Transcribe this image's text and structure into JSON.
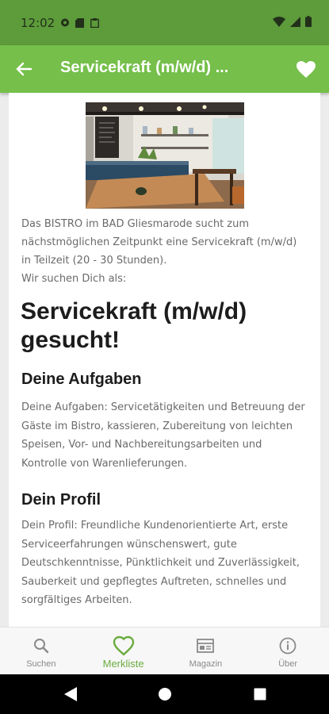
{
  "status_bar": {
    "time": "12:02"
  },
  "app_bar": {
    "title": "Servicekraft (m/w/d) ..."
  },
  "content": {
    "intro": "Das BISTRO im BAD Gliesmarode sucht zum nächstmöglichen Zeitpunkt eine Servicekraft (m/w/d) in Teilzeit (20 - 30 Stunden).\nWir suchen Dich als:",
    "headline": "Servicekraft (m/w/d) gesucht!",
    "tasks_title": "Deine Aufgaben",
    "tasks_text": "Deine Aufgaben: Servicetätigkeiten und Betreuung der Gäste im Bistro, kassieren, Zubereitung von leichten Speisen, Vor- und Nachbereitungsarbeiten und Kontrolle von Warenlieferungen.",
    "profile_title": "Dein Profil",
    "profile_text": "Dein Profil: Freundliche Kundenorientierte Art, erste Serviceerfahrungen wünschenswert, gute Deutschkenntnisse, Pünktlichkeit und Zuverlässigkeit, Sauberkeit und gepflegtes Auftreten, schnelles und sorgfältiges Arbeiten."
  },
  "bottom_nav": {
    "items": [
      {
        "label": "Suchen",
        "icon": "search-icon"
      },
      {
        "label": "Merkliste",
        "icon": "heart-outline-icon",
        "active": true
      },
      {
        "label": "Magazin",
        "icon": "newspaper-icon"
      },
      {
        "label": "Über",
        "icon": "info-icon"
      }
    ]
  },
  "colors": {
    "primary": "#75bf4a",
    "primary_dark": "#5d9b3b",
    "accent_text": "#6aab3f"
  }
}
